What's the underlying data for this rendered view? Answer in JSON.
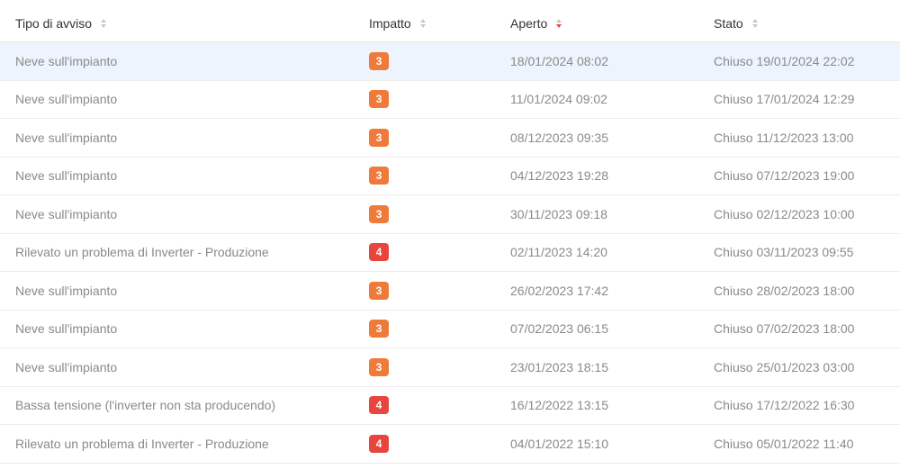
{
  "columns": {
    "type": "Tipo di avviso",
    "impact": "Impatto",
    "opened": "Aperto",
    "status": "Stato"
  },
  "sort": {
    "column": "opened",
    "direction": "desc"
  },
  "colors": {
    "impact_3": "#f07a3a",
    "impact_4": "#e8453c",
    "highlight": "#edf4fd"
  },
  "rows": [
    {
      "type": "Neve sull'impianto",
      "impact": "3",
      "opened": "18/01/2024 08:02",
      "status": "Chiuso 19/01/2024 22:02"
    },
    {
      "type": "Neve sull'impianto",
      "impact": "3",
      "opened": "11/01/2024 09:02",
      "status": "Chiuso 17/01/2024 12:29"
    },
    {
      "type": "Neve sull'impianto",
      "impact": "3",
      "opened": "08/12/2023 09:35",
      "status": "Chiuso 11/12/2023 13:00"
    },
    {
      "type": "Neve sull'impianto",
      "impact": "3",
      "opened": "04/12/2023 19:28",
      "status": "Chiuso 07/12/2023 19:00"
    },
    {
      "type": "Neve sull'impianto",
      "impact": "3",
      "opened": "30/11/2023 09:18",
      "status": "Chiuso 02/12/2023 10:00"
    },
    {
      "type": "Rilevato un problema di Inverter - Produzione",
      "impact": "4",
      "opened": "02/11/2023 14:20",
      "status": "Chiuso 03/11/2023 09:55"
    },
    {
      "type": "Neve sull'impianto",
      "impact": "3",
      "opened": "26/02/2023 17:42",
      "status": "Chiuso 28/02/2023 18:00"
    },
    {
      "type": "Neve sull'impianto",
      "impact": "3",
      "opened": "07/02/2023 06:15",
      "status": "Chiuso 07/02/2023 18:00"
    },
    {
      "type": "Neve sull'impianto",
      "impact": "3",
      "opened": "23/01/2023 18:15",
      "status": "Chiuso 25/01/2023 03:00"
    },
    {
      "type": "Bassa tensione (l'inverter non sta producendo)",
      "impact": "4",
      "opened": "16/12/2022 13:15",
      "status": "Chiuso 17/12/2022 16:30"
    },
    {
      "type": "Rilevato un problema di Inverter - Produzione",
      "impact": "4",
      "opened": "04/01/2022 15:10",
      "status": "Chiuso 05/01/2022 11:40"
    }
  ]
}
